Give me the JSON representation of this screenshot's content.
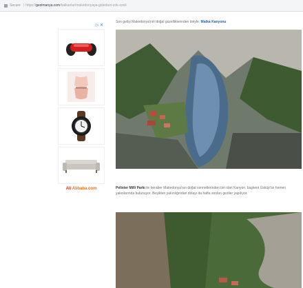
{
  "browser": {
    "secure_label": "Secure",
    "protocol": "https://",
    "host": "gezimanya.com",
    "path": "/balkanlar/makedonyaya-giderken-cok-ozeli"
  },
  "ads": {
    "adchoice_label": "▷ ✕",
    "products": [
      {
        "icon": "hoverboard-icon"
      },
      {
        "icon": "swimwear-icon"
      },
      {
        "icon": "wristwatch-icon"
      },
      {
        "icon": "sofa-icon"
      }
    ],
    "brand_prefix": "Ali",
    "brand_name": "Alibaba.com"
  },
  "article": {
    "intro_text": "Son gelişi Makedonya'nın doğal güzelliklerinden biriyle: ",
    "intro_link": "Matka Kanyonu",
    "caption_bold": "Pelister Milli Parkı",
    "caption_text": " ile beraber Makedonya'nın doğal cennetlerinden biri olan Kanyon, başkent Üsküp'ün hemen yakınlarında bulunuyor. Beşikten yakınlığından dolayı da hafta sonları geziler yapılıyor."
  },
  "colors": {
    "accent_link": "#1f5fb5",
    "alibaba_orange": "#ff6a00"
  }
}
